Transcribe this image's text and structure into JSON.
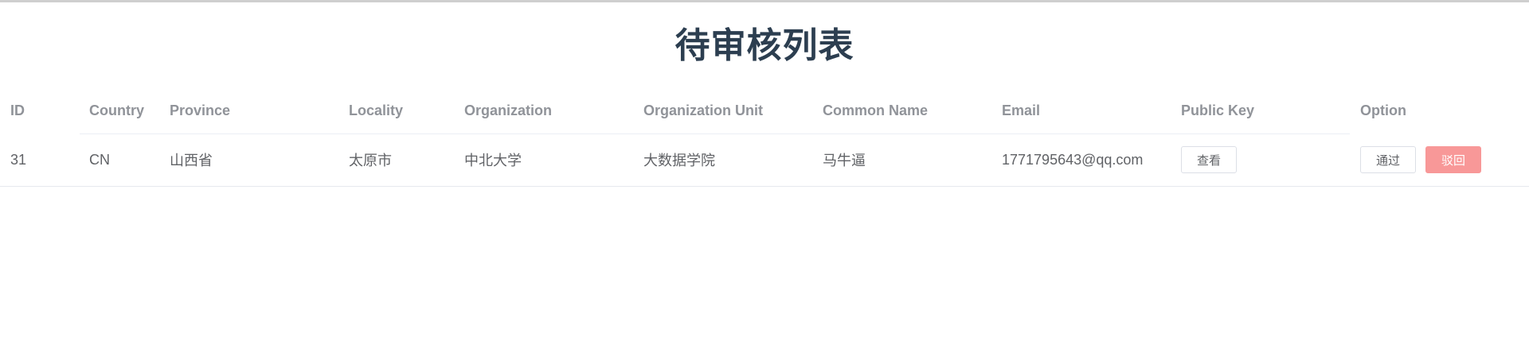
{
  "page": {
    "title": "待审核列表"
  },
  "table": {
    "headers": {
      "id": "ID",
      "country": "Country",
      "province": "Province",
      "locality": "Locality",
      "organization": "Organization",
      "organization_unit": "Organization Unit",
      "common_name": "Common Name",
      "email": "Email",
      "public_key": "Public Key",
      "option": "Option"
    },
    "rows": [
      {
        "id": "31",
        "country": "CN",
        "province": "山西省",
        "locality": "太原市",
        "organization": "中北大学",
        "organization_unit": "大数据学院",
        "common_name": "马牛逼",
        "email": "1771795643@qq.com",
        "view_label": "查看",
        "approve_label": "通过",
        "reject_label": "驳回"
      }
    ]
  },
  "colors": {
    "title": "#2c3e50",
    "header_text": "#909399",
    "body_text": "#606266",
    "danger_button": "#f89898"
  }
}
